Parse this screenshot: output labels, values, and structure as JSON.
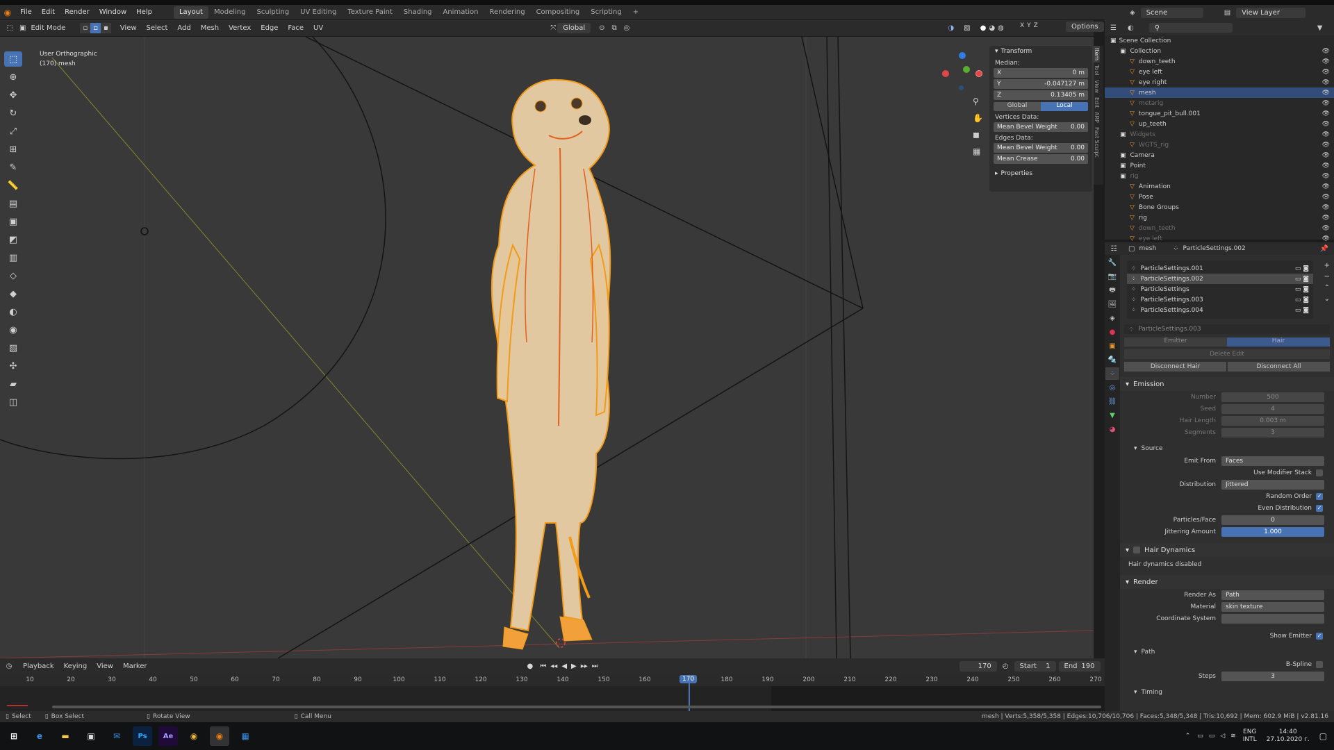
{
  "topbar": {
    "menus": [
      "File",
      "Edit",
      "Render",
      "Window",
      "Help"
    ],
    "workspaces": [
      "Layout",
      "Modeling",
      "Sculpting",
      "UV Editing",
      "Texture Paint",
      "Shading",
      "Animation",
      "Rendering",
      "Compositing",
      "Scripting"
    ],
    "active_workspace": "Layout",
    "add_tab": "+",
    "scene": "Scene",
    "view_layer": "View Layer"
  },
  "vpheader": {
    "mode": "Edit Mode",
    "menus": [
      "View",
      "Select",
      "Add",
      "Mesh",
      "Vertex",
      "Edge",
      "Face",
      "UV"
    ],
    "orientation": "Global",
    "options": "Options"
  },
  "viewport": {
    "view_name": "User Orthographic",
    "object_info": "(170) mesh"
  },
  "npanel": {
    "transform_title": "Transform",
    "median_label": "Median:",
    "x_label": "X",
    "x_value": "0 m",
    "y_label": "Y",
    "y_value": "-0.047127 m",
    "z_label": "Z",
    "z_value": "0.13405 m",
    "global": "Global",
    "local": "Local",
    "vertices_data": "Vertices Data:",
    "mean_bevel_weight": "Mean Bevel Weight",
    "mbw_v": "0.00",
    "edges_data": "Edges Data:",
    "mean_bevel_weight_e": "Mean Bevel Weight",
    "mbwe_v": "0.00",
    "mean_crease": "Mean Crease",
    "mc_v": "0.00",
    "properties": "Properties",
    "tabs": [
      "Item",
      "Tool",
      "View",
      "Edit",
      "ARP",
      "Fast Sculpt"
    ]
  },
  "timeline": {
    "menus": [
      "Playback",
      "Keying",
      "View",
      "Marker"
    ],
    "current_frame": "170",
    "start_label": "Start",
    "start": "1",
    "end_label": "End",
    "end": "190",
    "ticks": [
      "10",
      "20",
      "30",
      "40",
      "50",
      "60",
      "70",
      "80",
      "90",
      "100",
      "110",
      "120",
      "130",
      "140",
      "150",
      "160",
      "170",
      "180",
      "190",
      "200",
      "210",
      "220",
      "230",
      "240",
      "250",
      "260",
      "270"
    ]
  },
  "statusbar": {
    "select": "Select",
    "box_select": "Box Select",
    "rotate_view": "Rotate View",
    "call_menu": "Call Menu",
    "stats": "mesh | Verts:5,358/5,358 | Edges:10,706/10,706 | Faces:5,348/5,348 | Tris:10,692 | Mem: 602.9 MiB | v2.81.16"
  },
  "outliner": {
    "root": "Scene Collection",
    "items": [
      {
        "name": "Collection",
        "indent": 1,
        "dim": false,
        "sel": false
      },
      {
        "name": "down_teeth",
        "indent": 2,
        "dim": false,
        "sel": false
      },
      {
        "name": "eye left",
        "indent": 2,
        "dim": false,
        "sel": false
      },
      {
        "name": "eye right",
        "indent": 2,
        "dim": false,
        "sel": false
      },
      {
        "name": "mesh",
        "indent": 2,
        "dim": false,
        "sel": true
      },
      {
        "name": "metarig",
        "indent": 2,
        "dim": true,
        "sel": false
      },
      {
        "name": "tongue_pit_bull.001",
        "indent": 2,
        "dim": false,
        "sel": false
      },
      {
        "name": "up_teeth",
        "indent": 2,
        "dim": false,
        "sel": false
      },
      {
        "name": "Widgets",
        "indent": 1,
        "dim": true,
        "sel": false
      },
      {
        "name": "WGTS_rig",
        "indent": 2,
        "dim": true,
        "sel": false
      },
      {
        "name": "Camera",
        "indent": 1,
        "dim": false,
        "sel": false
      },
      {
        "name": "Point",
        "indent": 1,
        "dim": false,
        "sel": false
      },
      {
        "name": "rig",
        "indent": 1,
        "dim": true,
        "sel": false
      },
      {
        "name": "Animation",
        "indent": 2,
        "dim": false,
        "sel": false
      },
      {
        "name": "Pose",
        "indent": 2,
        "dim": false,
        "sel": false
      },
      {
        "name": "Bone Groups",
        "indent": 2,
        "dim": false,
        "sel": false
      },
      {
        "name": "rig",
        "indent": 2,
        "dim": false,
        "sel": false
      },
      {
        "name": "down_teeth",
        "indent": 2,
        "dim": true,
        "sel": false
      },
      {
        "name": "eye left",
        "indent": 2,
        "dim": true,
        "sel": false
      }
    ]
  },
  "props": {
    "object": "mesh",
    "settings": "ParticleSettings.002",
    "list": [
      {
        "name": "ParticleSettings.001",
        "sel": false
      },
      {
        "name": "ParticleSettings.002",
        "sel": true
      },
      {
        "name": "ParticleSettings",
        "sel": false
      },
      {
        "name": "ParticleSettings.003",
        "sel": false
      },
      {
        "name": "ParticleSettings.004",
        "sel": false
      }
    ],
    "active_settings": "ParticleSettings.003",
    "emitter": "Emitter",
    "hair": "Hair",
    "delete_edit": "Delete Edit",
    "disconnect_hair": "Disconnect Hair",
    "disconnect_all": "Disconnect All",
    "emission": "Emission",
    "number_l": "Number",
    "number": "500",
    "seed_l": "Seed",
    "seed": "4",
    "hair_length_l": "Hair Length",
    "hair_length": "0.003 m",
    "segments_l": "Segments",
    "segments": "3",
    "source": "Source",
    "emit_from_l": "Emit From",
    "emit_from": "Faces",
    "use_modifier_stack": "Use Modifier Stack",
    "distribution_l": "Distribution",
    "distribution": "Jittered",
    "random_order": "Random Order",
    "even_distribution": "Even Distribution",
    "particles_face_l": "Particles/Face",
    "particles_face": "0",
    "jittering_amount_l": "Jittering Amount",
    "jittering_amount": "1.000",
    "hair_dynamics": "Hair Dynamics",
    "hair_dynamics_disabled": "Hair dynamics disabled",
    "render": "Render",
    "render_as_l": "Render As",
    "render_as": "Path",
    "material_l": "Material",
    "material": "skin texture",
    "coord_system_l": "Coordinate System",
    "show_emitter": "Show Emitter",
    "path": "Path",
    "bspline": "B-Spline",
    "steps_l": "Steps",
    "steps": "3",
    "timing": "Timing"
  },
  "taskbar": {
    "apps": [
      "Ps",
      "Ae"
    ],
    "lang1": "ENG",
    "lang2": "INTL",
    "time": "14:40",
    "date": "27.10.2020 г."
  },
  "colors": {
    "accent": "#4772b3",
    "mesh": "#f29a1e",
    "selected_row": "#334d7a"
  }
}
